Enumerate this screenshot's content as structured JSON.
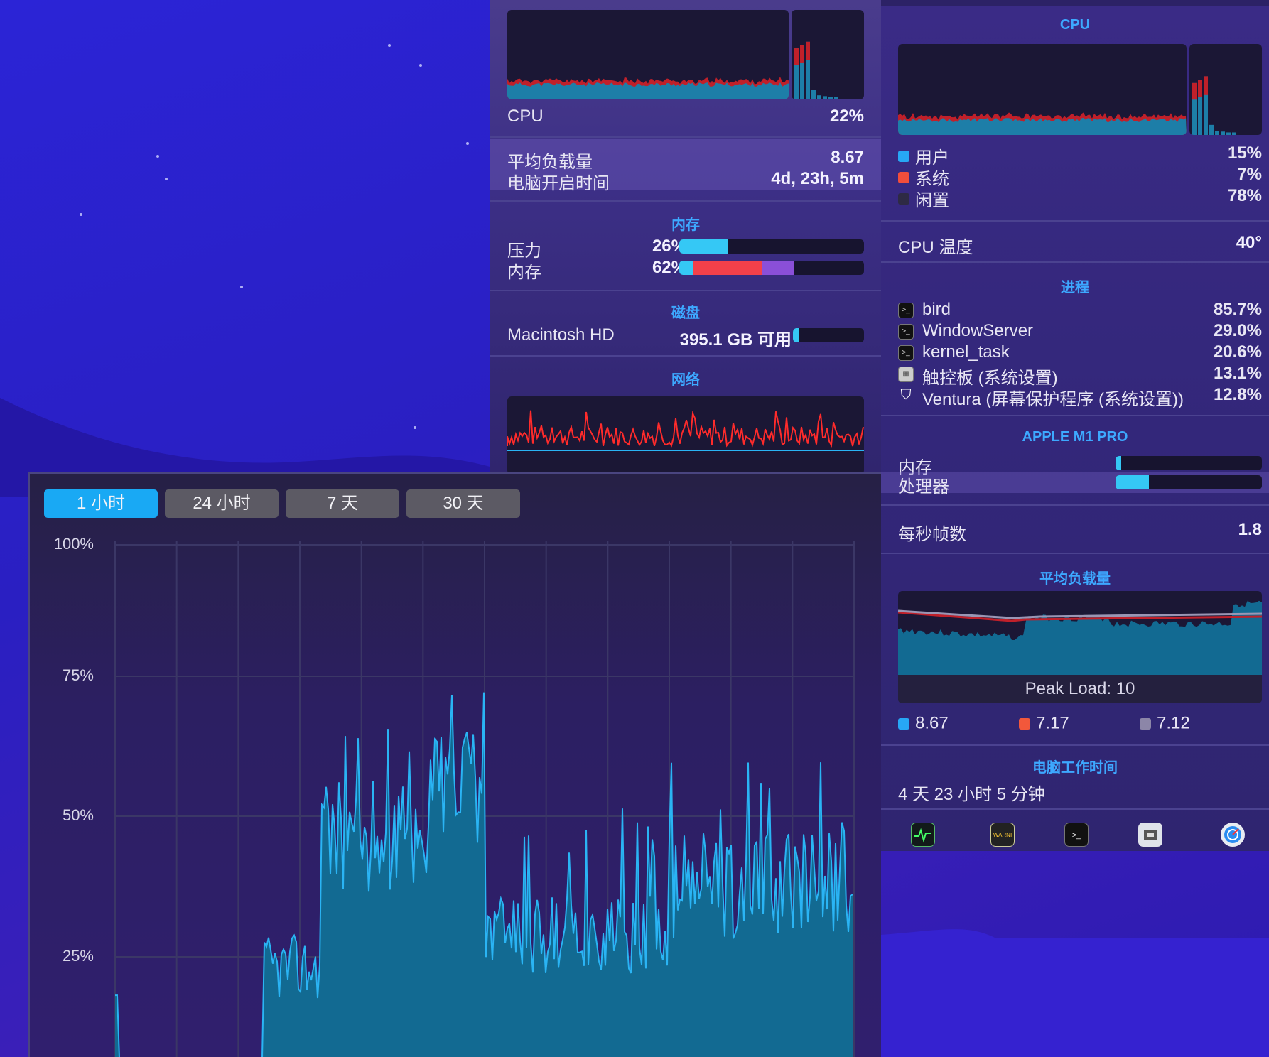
{
  "cpu_menu": {
    "cpu_label": "CPU",
    "cpu_value": "22%",
    "load_label": "平均负载量",
    "load_value": "8.67",
    "uptime_label": "电脑开启时间",
    "uptime_value": "4d, 23h, 5m",
    "memory_title": "内存",
    "pressure_label": "压力",
    "pressure_value": "26%",
    "pressure_fraction": 0.26,
    "memory_label": "内存",
    "memory_value": "62%",
    "memory_fraction": 0.62,
    "disk_title": "磁盘",
    "disk_name": "Macintosh HD",
    "disk_value": "395.1 GB 可用",
    "disk_fraction": 0.08,
    "network_title": "网络"
  },
  "cpu_detail": {
    "title": "CPU",
    "legend": [
      {
        "label": "用户",
        "value": "15%",
        "color": "#27a7f5"
      },
      {
        "label": "系统",
        "value": "7%",
        "color": "#f24e3b"
      },
      {
        "label": "闲置",
        "value": "78%",
        "color": "#2e2a44"
      }
    ],
    "temp_label": "CPU 温度",
    "temp_value": "40°",
    "processes_title": "进程",
    "processes": [
      {
        "name": "bird",
        "value": "85.7%",
        "icon": "terminal-icon"
      },
      {
        "name": "WindowServer",
        "value": "29.0%",
        "icon": "terminal-icon"
      },
      {
        "name": "kernel_task",
        "value": "20.6%",
        "icon": "terminal-icon"
      },
      {
        "name": "触控板 (系统设置)",
        "value": "13.1%",
        "icon": "trackpad-icon"
      },
      {
        "name": "Ventura (屏幕保护程序 (系统设置))",
        "value": "12.8%",
        "icon": "shield-icon"
      }
    ],
    "gpu_title": "APPLE M1 PRO",
    "gpu_memory_label": "内存",
    "gpu_memory_fraction": 0.04,
    "gpu_processor_label": "处理器",
    "gpu_processor_fraction": 0.23,
    "fps_label": "每秒帧数",
    "fps_value": "1.8",
    "load_title": "平均负载量",
    "peak_label": "Peak Load: 10",
    "load_values": [
      {
        "value": "8.67",
        "color": "#27a7f5"
      },
      {
        "value": "7.17",
        "color": "#f2583b"
      },
      {
        "value": "7.12",
        "color": "#8c86a8"
      }
    ],
    "uptime_title": "电脑工作时间",
    "uptime_value": "4 天 23 小时 5 分钟",
    "dock_icons": [
      "activity-monitor-icon",
      "console-icon",
      "terminal-icon",
      "system-information-icon",
      "disk-utility-icon"
    ],
    "console_text": "WARNI",
    "terminal_text": ">_"
  },
  "history": {
    "tabs": [
      "1 小时",
      "24 小时",
      "7 天",
      "30 天"
    ],
    "active_tab": 0,
    "y_labels": [
      "100%",
      "75%",
      "50%",
      "25%"
    ],
    "colors": {
      "fill": "#126a92",
      "line": "#2ab4f4",
      "accent": "#19a9f4"
    }
  }
}
